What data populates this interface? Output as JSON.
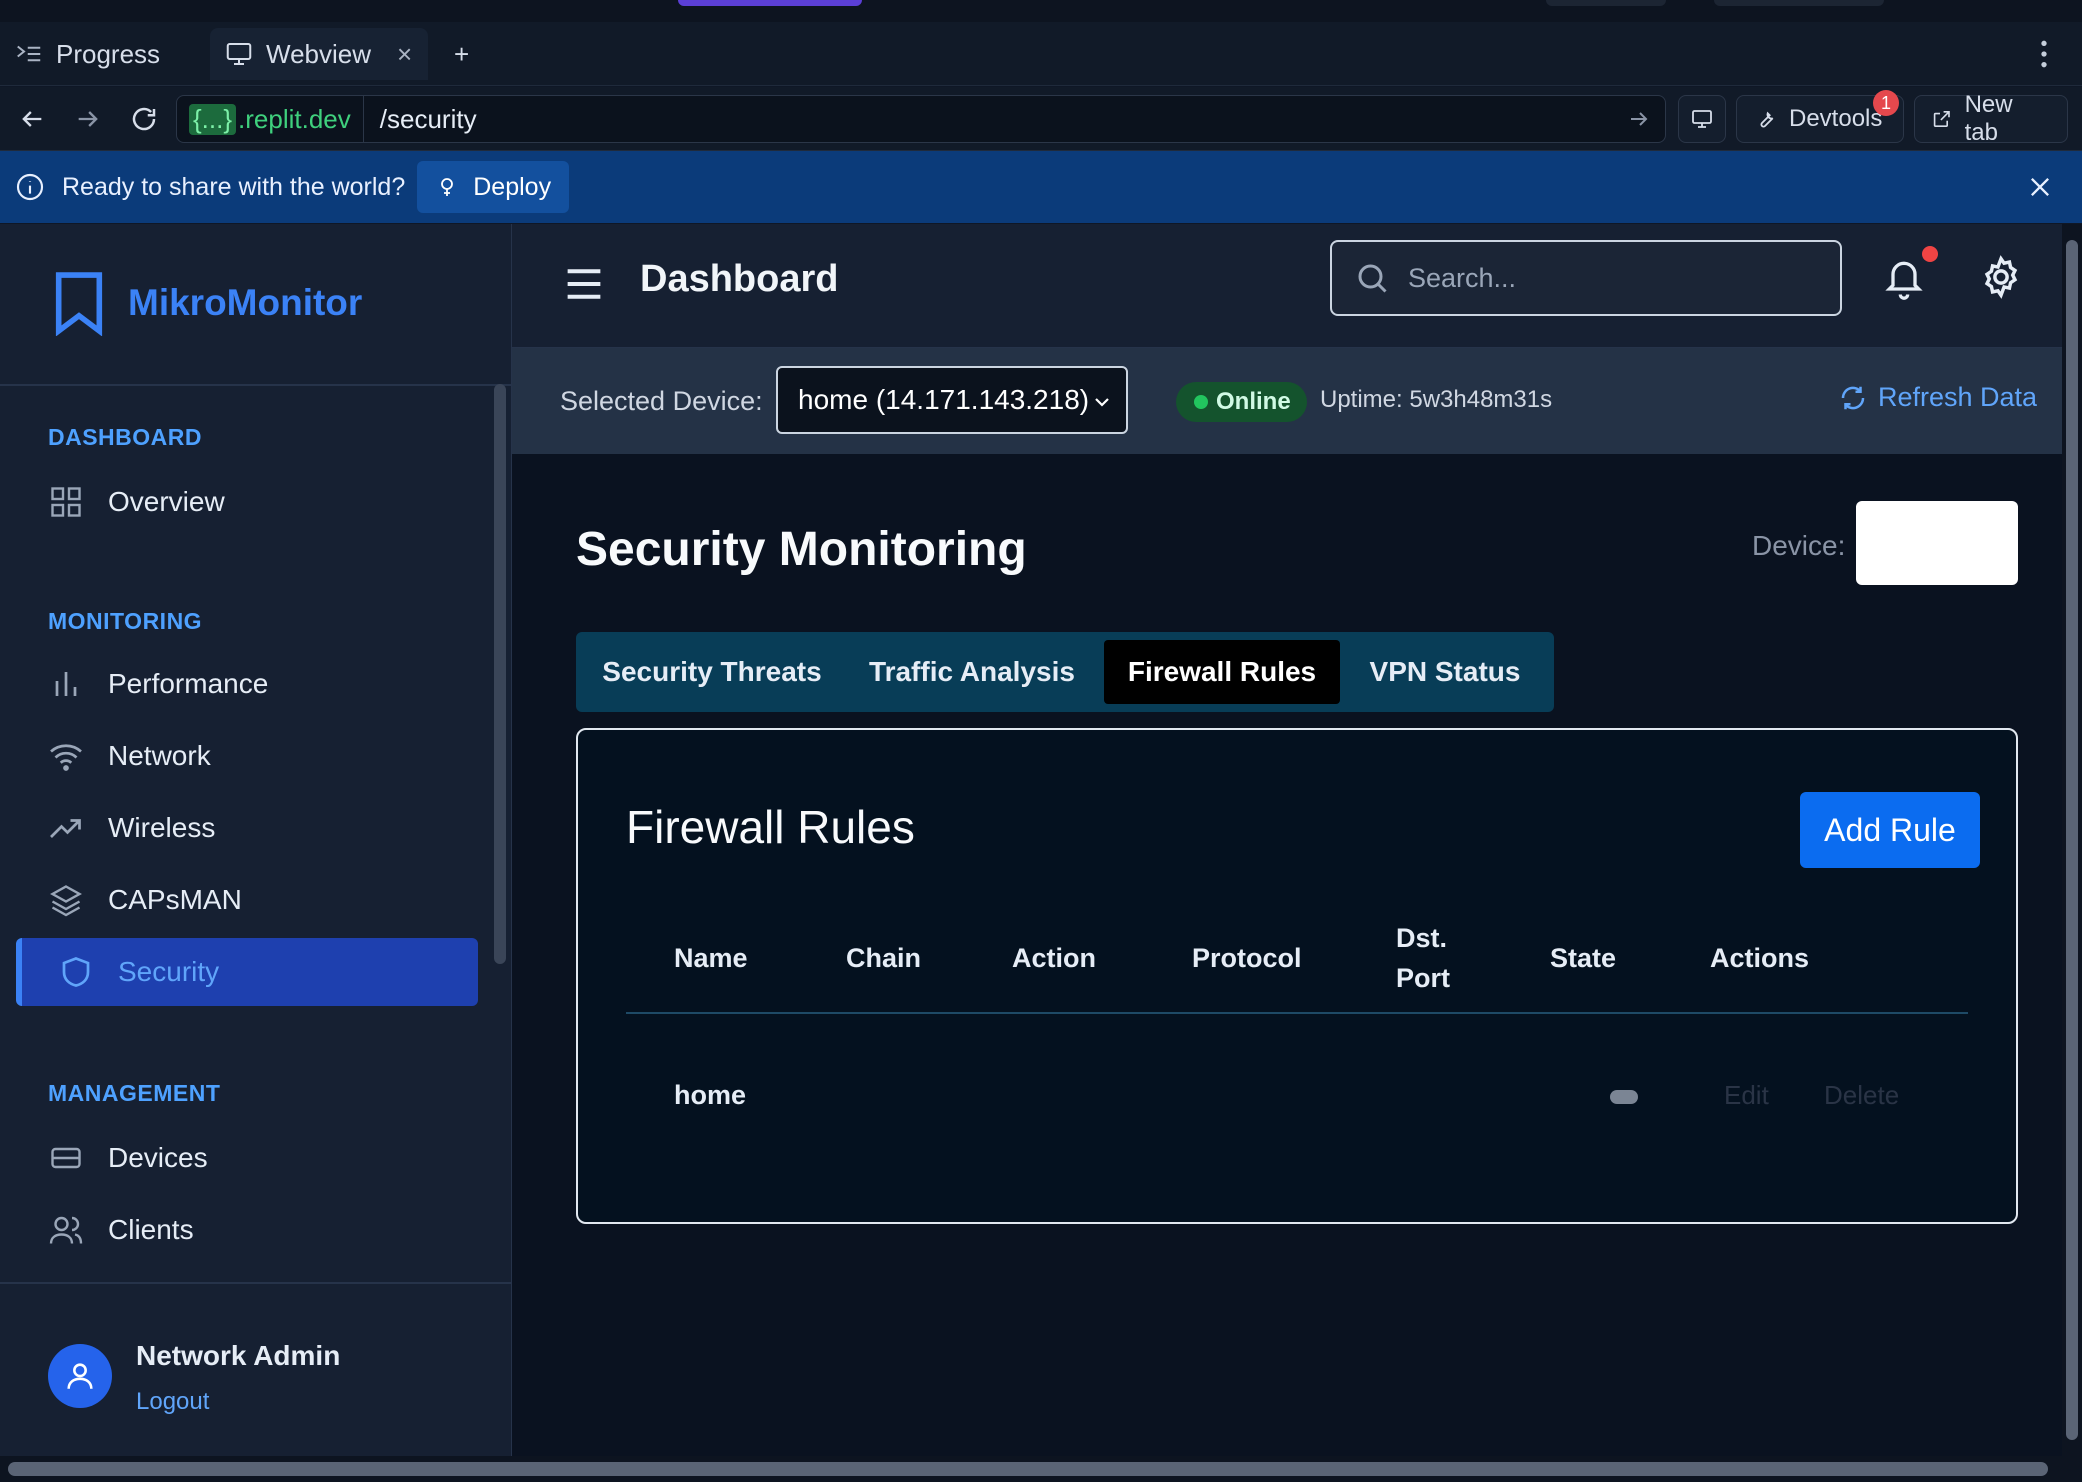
{
  "browser": {
    "tabs": [
      {
        "label": "Progress",
        "icon": "progress-icon"
      },
      {
        "label": "Webview",
        "icon": "monitor-icon",
        "close": "×"
      }
    ],
    "new_tab_symbol": "+",
    "url": {
      "host_braces": "{...}",
      "host": ".replit.dev",
      "path": "/security"
    },
    "devtools_label": "Devtools",
    "devtools_badge": "1",
    "newtab_label": "New tab"
  },
  "banner": {
    "text": "Ready to share with the world?",
    "deploy_label": "Deploy"
  },
  "sidebar": {
    "brand": "MikroMonitor",
    "sections": [
      {
        "heading": "DASHBOARD",
        "items": [
          {
            "label": "Overview",
            "icon": "grid-icon"
          }
        ]
      },
      {
        "heading": "MONITORING",
        "items": [
          {
            "label": "Performance",
            "icon": "bar-chart-icon"
          },
          {
            "label": "Network",
            "icon": "wifi-icon"
          },
          {
            "label": "Wireless",
            "icon": "trending-icon"
          },
          {
            "label": "CAPsMAN",
            "icon": "layers-icon"
          },
          {
            "label": "Security",
            "icon": "shield-icon",
            "active": true
          }
        ]
      },
      {
        "heading": "MANAGEMENT",
        "items": [
          {
            "label": "Devices",
            "icon": "server-icon"
          },
          {
            "label": "Clients",
            "icon": "users-icon"
          }
        ]
      }
    ],
    "user": {
      "name": "Network Admin",
      "logout": "Logout"
    }
  },
  "header": {
    "title": "Dashboard",
    "search_placeholder": "Search..."
  },
  "device_bar": {
    "label": "Selected Device:",
    "selected": "home (14.171.143.218)",
    "status": "Online",
    "uptime": "Uptime: 5w3h48m31s",
    "refresh": "Refresh Data"
  },
  "content": {
    "title": "Security Monitoring",
    "device_label": "Device:",
    "tabs": [
      "Security Threats",
      "Traffic Analysis",
      "Firewall Rules",
      "VPN Status"
    ],
    "active_tab": "Firewall Rules",
    "card": {
      "title": "Firewall Rules",
      "add_button": "Add Rule",
      "columns": [
        "Name",
        "Chain",
        "Action",
        "Protocol",
        "Dst. Port",
        "State",
        "Actions"
      ],
      "columns_split": {
        "dst_port_line1": "Dst.",
        "dst_port_line2": "Port"
      },
      "rows": [
        {
          "name": "home",
          "chain": "",
          "action": "",
          "protocol": "",
          "dst_port": "",
          "state": "",
          "edit": "Edit",
          "delete": "Delete"
        }
      ]
    }
  },
  "colors": {
    "accent": "#3b82f6",
    "online": "#22c55e",
    "banner": "#0b3b7a",
    "active_nav": "#1e40af",
    "add_button": "#0b6cf0"
  }
}
